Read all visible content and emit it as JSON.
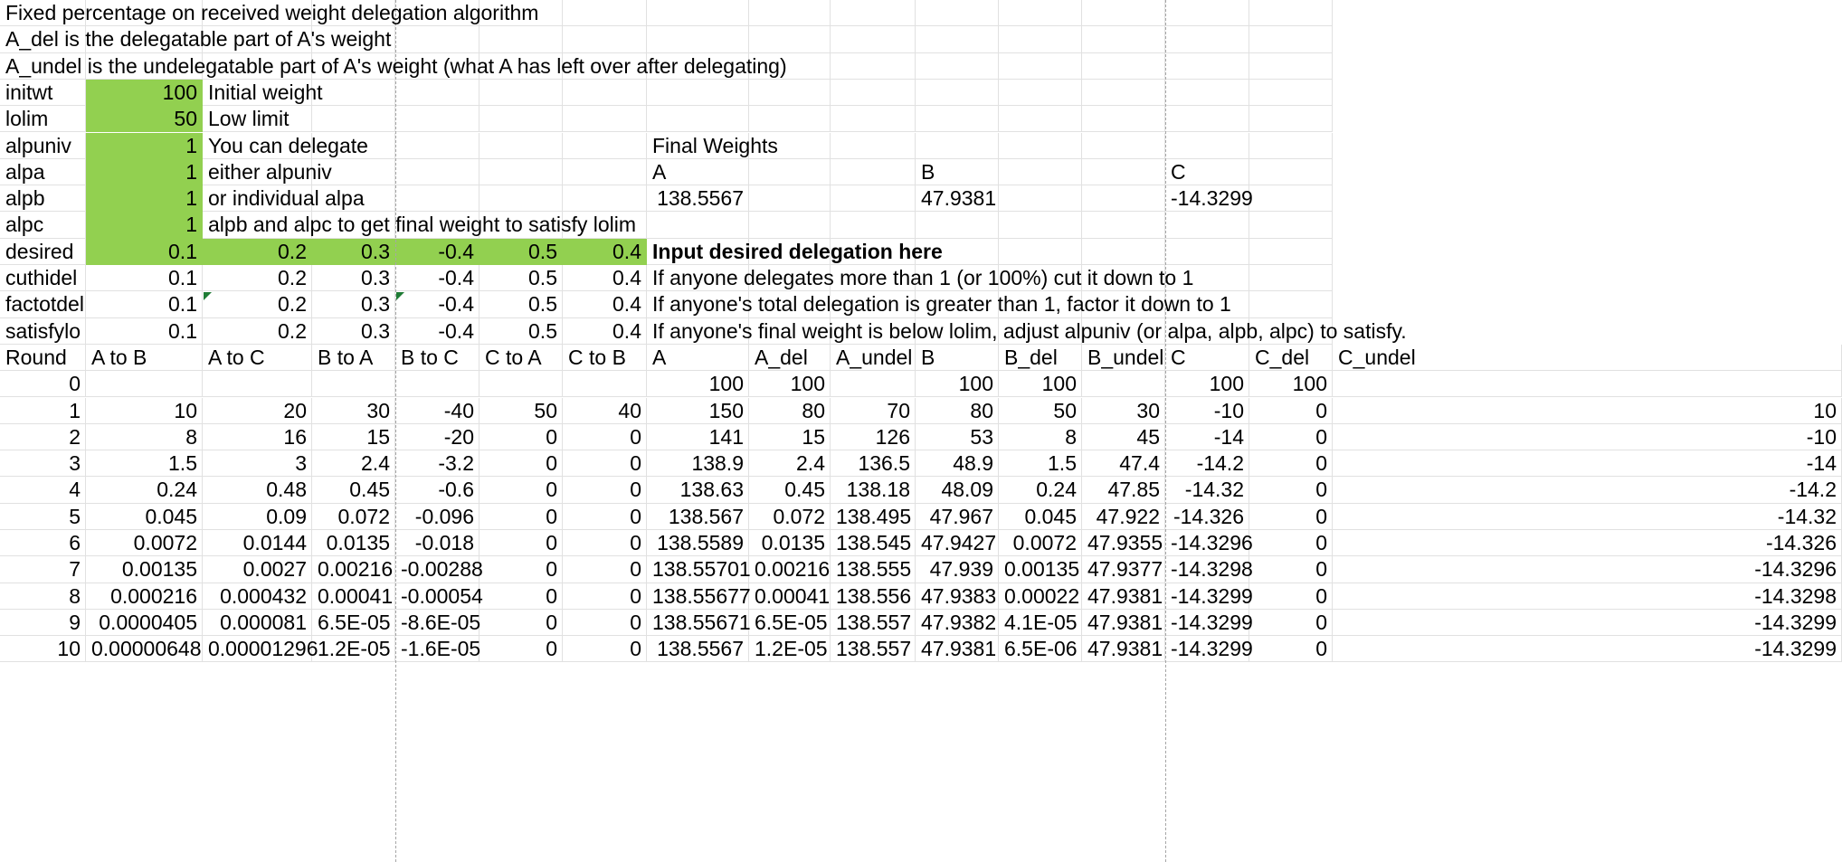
{
  "sheet": {
    "rows": [
      [
        "Fixed percentage on received weight delegation algorithm",
        "",
        "",
        "",
        "",
        "",
        "",
        "",
        "",
        "",
        "",
        "",
        "",
        "",
        ""
      ],
      [
        "A_del is the delegatable part of A's weight",
        "",
        "",
        "",
        "",
        "",
        "",
        "",
        "",
        "",
        "",
        "",
        "",
        "",
        ""
      ],
      [
        "A_undel is the undelegatable part of A's weight (what A has left over after delegating)",
        "",
        "",
        "",
        "",
        "",
        "",
        "",
        "",
        "",
        "",
        "",
        "",
        "",
        ""
      ],
      [
        "initwt",
        "100",
        "Initial weight",
        "",
        "",
        "",
        "",
        "",
        "",
        "",
        "",
        "",
        "",
        "",
        ""
      ],
      [
        "lolim",
        "50",
        "Low limit",
        "",
        "",
        "",
        "",
        "",
        "",
        "",
        "",
        "",
        "",
        "",
        ""
      ],
      [
        "alpuniv",
        "1",
        "You can delegate",
        "",
        "",
        "",
        "",
        "Final Weights",
        "",
        "",
        "",
        "",
        "",
        "",
        ""
      ],
      [
        "alpa",
        "1",
        "either alpuniv",
        "",
        "",
        "",
        "",
        "A",
        "",
        "",
        "B",
        "",
        "",
        "C",
        ""
      ],
      [
        "alpb",
        "1",
        "or individual alpa",
        "",
        "",
        "",
        "",
        "138.5567",
        "",
        "",
        "47.9381",
        "",
        "",
        "-14.3299",
        ""
      ],
      [
        "alpc",
        "1",
        "alpb and alpc to get final weight to satisfy lolim",
        "",
        "",
        "",
        "",
        "",
        "",
        "",
        "",
        "",
        "",
        "",
        ""
      ],
      [
        "desired",
        "0.1",
        "0.2",
        "0.3",
        "-0.4",
        "0.5",
        "0.4",
        "Input desired delegation here",
        "",
        "",
        "",
        "",
        "",
        "",
        ""
      ],
      [
        "cuthidel",
        "0.1",
        "0.2",
        "0.3",
        "-0.4",
        "0.5",
        "0.4",
        "If anyone delegates more than 1 (or 100%) cut it down to 1",
        "",
        "",
        "",
        "",
        "",
        "",
        ""
      ],
      [
        "factotdel",
        "0.1",
        "0.2",
        "0.3",
        "-0.4",
        "0.5",
        "0.4",
        "If anyone's total delegation is greater than 1, factor it down to 1",
        "",
        "",
        "",
        "",
        "",
        "",
        ""
      ],
      [
        "satisfylo",
        "0.1",
        "0.2",
        "0.3",
        "-0.4",
        "0.5",
        "0.4",
        "If anyone's final weight is below lolim, adjust alpuniv (or alpa, alpb, alpc) to satisfy.",
        "",
        "",
        "",
        "",
        "",
        "",
        ""
      ],
      [
        "Round",
        "A to B",
        "A to C",
        "B to A",
        "B to C",
        "C to A",
        "C to B",
        "A",
        "A_del",
        "A_undel",
        "B",
        "B_del",
        "B_undel",
        "C",
        "C_del",
        "C_undel"
      ],
      [
        "0",
        "",
        "",
        "",
        "",
        "",
        "",
        "100",
        "100",
        "",
        "100",
        "100",
        "",
        "100",
        "100",
        ""
      ],
      [
        "1",
        "10",
        "20",
        "30",
        "-40",
        "50",
        "40",
        "150",
        "80",
        "70",
        "80",
        "50",
        "30",
        "-10",
        "0",
        "10"
      ],
      [
        "2",
        "8",
        "16",
        "15",
        "-20",
        "0",
        "0",
        "141",
        "15",
        "126",
        "53",
        "8",
        "45",
        "-14",
        "0",
        "-10"
      ],
      [
        "3",
        "1.5",
        "3",
        "2.4",
        "-3.2",
        "0",
        "0",
        "138.9",
        "2.4",
        "136.5",
        "48.9",
        "1.5",
        "47.4",
        "-14.2",
        "0",
        "-14"
      ],
      [
        "4",
        "0.24",
        "0.48",
        "0.45",
        "-0.6",
        "0",
        "0",
        "138.63",
        "0.45",
        "138.18",
        "48.09",
        "0.24",
        "47.85",
        "-14.32",
        "0",
        "-14.2"
      ],
      [
        "5",
        "0.045",
        "0.09",
        "0.072",
        "-0.096",
        "0",
        "0",
        "138.567",
        "0.072",
        "138.495",
        "47.967",
        "0.045",
        "47.922",
        "-14.326",
        "0",
        "-14.32"
      ],
      [
        "6",
        "0.0072",
        "0.0144",
        "0.0135",
        "-0.018",
        "0",
        "0",
        "138.5589",
        "0.0135",
        "138.545",
        "47.9427",
        "0.0072",
        "47.9355",
        "-14.3296",
        "0",
        "-14.326"
      ],
      [
        "7",
        "0.00135",
        "0.0027",
        "0.00216",
        "-0.00288",
        "0",
        "0",
        "138.55701",
        "0.00216",
        "138.555",
        "47.939",
        "0.00135",
        "47.9377",
        "-14.3298",
        "0",
        "-14.3296"
      ],
      [
        "8",
        "0.000216",
        "0.000432",
        "0.00041",
        "-0.00054",
        "0",
        "0",
        "138.55677",
        "0.00041",
        "138.556",
        "47.9383",
        "0.00022",
        "47.9381",
        "-14.3299",
        "0",
        "-14.3298"
      ],
      [
        "9",
        "0.0000405",
        "0.000081",
        "6.5E-05",
        "-8.6E-05",
        "0",
        "0",
        "138.55671",
        "6.5E-05",
        "138.557",
        "47.9382",
        "4.1E-05",
        "47.9381",
        "-14.3299",
        "0",
        "-14.3299"
      ],
      [
        "10",
        "0.00000648",
        "0.00001296",
        "1.2E-05",
        "-1.6E-05",
        "0",
        "0",
        "138.5567",
        "1.2E-05",
        "138.557",
        "47.9381",
        "6.5E-06",
        "47.9381",
        "-14.3299",
        "0",
        "-14.3299"
      ]
    ],
    "highlight_color": "#92d050",
    "gridline_color": "#e1e1e1",
    "page_break_color": "#a6a6a6",
    "comment_marker_color": "#1e7b34"
  }
}
